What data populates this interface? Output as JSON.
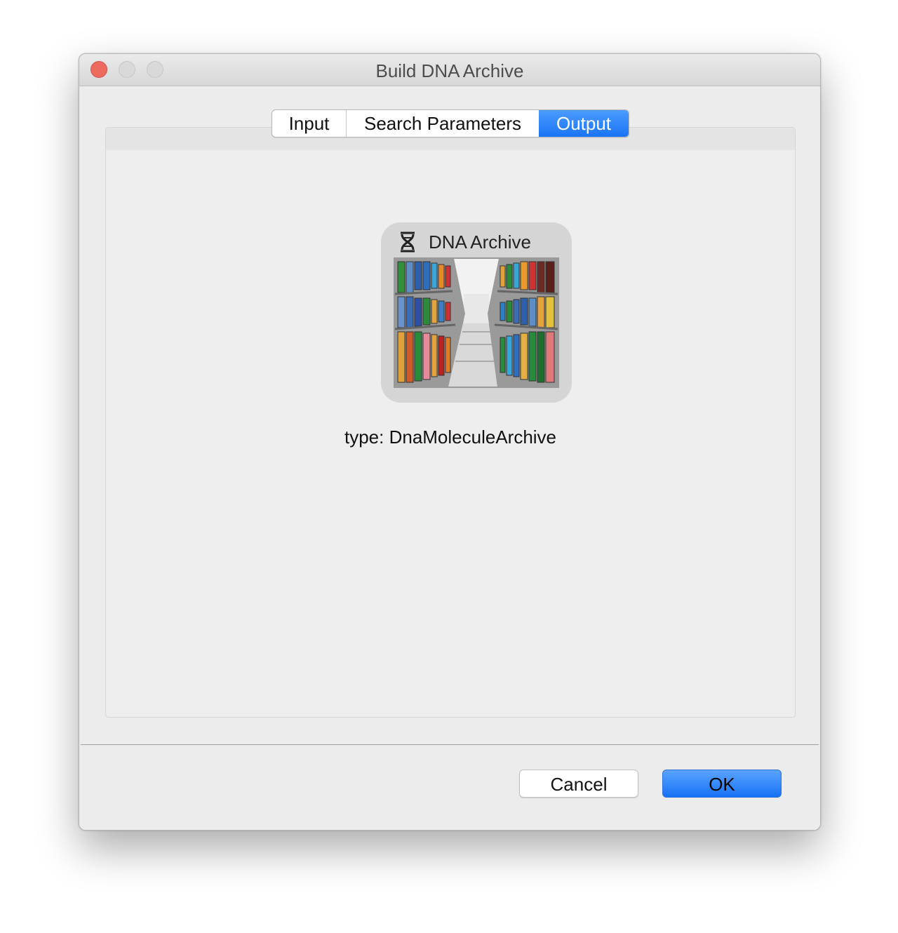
{
  "window": {
    "title": "Build DNA Archive",
    "traffic_lights": [
      "close",
      "minimize",
      "maximize"
    ]
  },
  "tabs": [
    {
      "label": "Input",
      "selected": false
    },
    {
      "label": "Search Parameters",
      "selected": false
    },
    {
      "label": "Output",
      "selected": true
    }
  ],
  "output": {
    "card_title": "DNA Archive",
    "card_icon": "dna-icon",
    "type_label": "type:",
    "type_value": "DnaMoleculeArchive"
  },
  "footer": {
    "cancel_label": "Cancel",
    "ok_label": "OK"
  },
  "colors": {
    "accent": "#1a74f5",
    "close": "#ed6a5e",
    "window_bg": "#ececec"
  }
}
